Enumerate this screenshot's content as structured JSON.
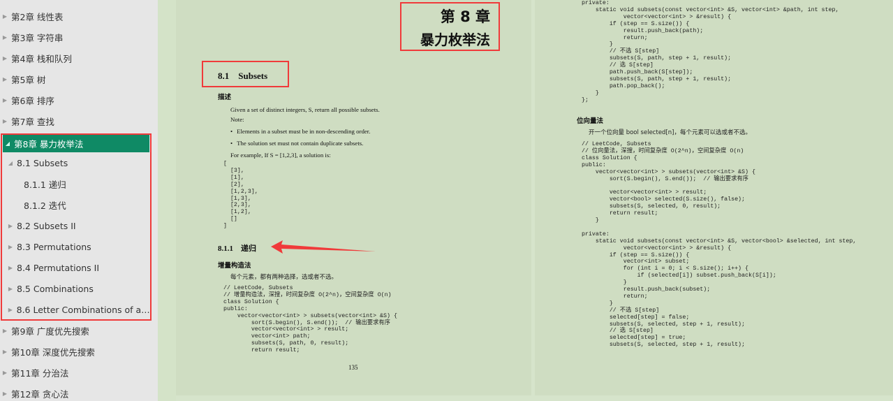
{
  "sidebar": {
    "items": [
      {
        "label": "第2章  线性表",
        "level": 0,
        "expanded": false
      },
      {
        "label": "第3章  字符串",
        "level": 0,
        "expanded": false
      },
      {
        "label": "第4章  栈和队列",
        "level": 0,
        "expanded": false
      },
      {
        "label": "第5章  树",
        "level": 0,
        "expanded": false
      },
      {
        "label": "第6章  排序",
        "level": 0,
        "expanded": false
      },
      {
        "label": "第7章  查找",
        "level": 0,
        "expanded": false
      },
      {
        "label": "第8章  暴力枚举法",
        "level": 0,
        "expanded": true,
        "active": true
      },
      {
        "label": "8.1 Subsets",
        "level": 1,
        "expanded": true
      },
      {
        "label": "8.1.1 递归",
        "level": 2
      },
      {
        "label": "8.1.2 迭代",
        "level": 2
      },
      {
        "label": "8.2 Subsets II",
        "level": 1,
        "expanded": false
      },
      {
        "label": "8.3 Permutations",
        "level": 1,
        "expanded": false
      },
      {
        "label": "8.4 Permutations II",
        "level": 1,
        "expanded": false
      },
      {
        "label": "8.5 Combinations",
        "level": 1,
        "expanded": false
      },
      {
        "label": "8.6 Letter Combinations of a P...",
        "level": 1,
        "expanded": false
      },
      {
        "label": "第9章  广度优先搜索",
        "level": 0,
        "expanded": false
      },
      {
        "label": "第10章  深度优先搜索",
        "level": 0,
        "expanded": false
      },
      {
        "label": "第11章  分治法",
        "level": 0,
        "expanded": false
      },
      {
        "label": "第12章  贪心法",
        "level": 0,
        "expanded": false
      }
    ],
    "active_color": "#0f8a65",
    "highlight_color": "#f03a3a"
  },
  "left_page": {
    "chapter_number": "第 8 章",
    "chapter_title": "暴力枚举法",
    "section_title": "8.1    Subsets",
    "description_heading": "描述",
    "description": "Given a set of distinct integers, S, return all possible subsets.",
    "note_label": "Note:",
    "bullets": [
      "Elements in a subset must be in non-descending order.",
      "The solution set must not contain duplicate subsets."
    ],
    "example_intro": "For example, If S = [1,2,3], a solution is:",
    "example_output": "[\n  [3],\n  [1],\n  [2],\n  [1,2,3],\n  [1,3],\n  [2,3],\n  [1,2],\n  []\n]",
    "subsection_title": "8.1.1    递归",
    "method_heading": "增量构造法",
    "method_desc": "每个元素，都有两种选择，选或者不选。",
    "code": "// LeetCode, Subsets\n// 增量构造法，深搜，时间复杂度 O(2^n)，空间复杂度 O(n)\nclass Solution {\npublic:\n    vector<vector<int> > subsets(vector<int> &S) {\n        sort(S.begin(), S.end());  // 输出要求有序\n        vector<vector<int> > result;\n        vector<int> path;\n        subsets(S, path, 0, result);\n        return result;",
    "page_number": "135"
  },
  "right_page": {
    "code_top": "private:\n    static void subsets(const vector<int> &S, vector<int> &path, int step,\n            vector<vector<int> > &result) {\n        if (step == S.size()) {\n            result.push_back(path);\n            return;\n        }\n        // 不选 S[step]\n        subsets(S, path, step + 1, result);\n        // 选 S[step]\n        path.push_back(S[step]);\n        subsets(S, path, step + 1, result);\n        path.pop_back();\n    }\n};",
    "method_heading": "位向量法",
    "method_desc": "开一个位向量 bool selected[n]，每个元素可以选或者不选。",
    "code_bottom": "// LeetCode, Subsets\n// 位向量法，深搜，时间复杂度 O(2^n)，空间复杂度 O(n)\nclass Solution {\npublic:\n    vector<vector<int> > subsets(vector<int> &S) {\n        sort(S.begin(), S.end());  // 输出要求有序\n\n        vector<vector<int> > result;\n        vector<bool> selected(S.size(), false);\n        subsets(S, selected, 0, result);\n        return result;\n    }\n\nprivate:\n    static void subsets(const vector<int> &S, vector<bool> &selected, int step,\n            vector<vector<int> > &result) {\n        if (step == S.size()) {\n            vector<int> subset;\n            for (int i = 0; i < S.size(); i++) {\n                if (selected[i]) subset.push_back(S[i]);\n            }\n            result.push_back(subset);\n            return;\n        }\n        // 不选 S[step]\n        selected[step] = false;\n        subsets(S, selected, step + 1, result);\n        // 选 S[step]\n        selected[step] = true;\n        subsets(S, selected, step + 1, result);"
  },
  "annotations": {
    "arrow_icon": "red-arrow-left",
    "arrow_color": "#f03a3a"
  }
}
